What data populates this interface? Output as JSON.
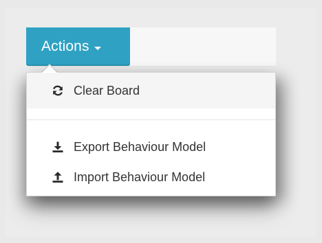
{
  "actions_button": {
    "label": "Actions",
    "icon": "caret-down-icon"
  },
  "menu": {
    "items": [
      {
        "label": "Clear Board",
        "icon": "refresh-icon"
      },
      {
        "label": "Export Behaviour Model",
        "icon": "download-icon"
      },
      {
        "label": "Import Behaviour Model",
        "icon": "upload-icon"
      }
    ]
  },
  "colors": {
    "accent": "#2fa2c4",
    "menu_bg": "#ffffff",
    "hover_bg": "#f5f5f5",
    "text": "#333333"
  }
}
